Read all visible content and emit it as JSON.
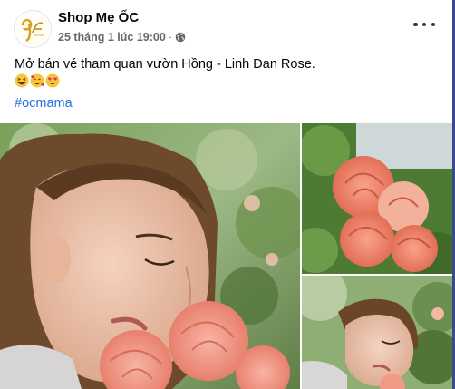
{
  "post": {
    "author": "Shop Mẹ ỐC",
    "timestamp": "25 tháng 1 lúc 19:00",
    "separator": "·",
    "privacy_icon": "globe-icon",
    "more_icon": "more-options-icon",
    "text": "Mở bán vé tham quan vườn Hồng - Linh Đan Rose.",
    "emojis": [
      "grinning-squinting-face",
      "smiling-face-with-hearts",
      "heart-eyes-face"
    ],
    "hashtag": "#ocmama",
    "photos": [
      {
        "subject": "woman smelling pink roses in garden"
      },
      {
        "subject": "cluster of coral pink roses"
      },
      {
        "subject": "woman smelling roses, second view"
      }
    ]
  },
  "colors": {
    "link": "#216fdb",
    "secondary_text": "#65676b",
    "rose": "#f08878",
    "foliage": "#5e8a3c"
  }
}
